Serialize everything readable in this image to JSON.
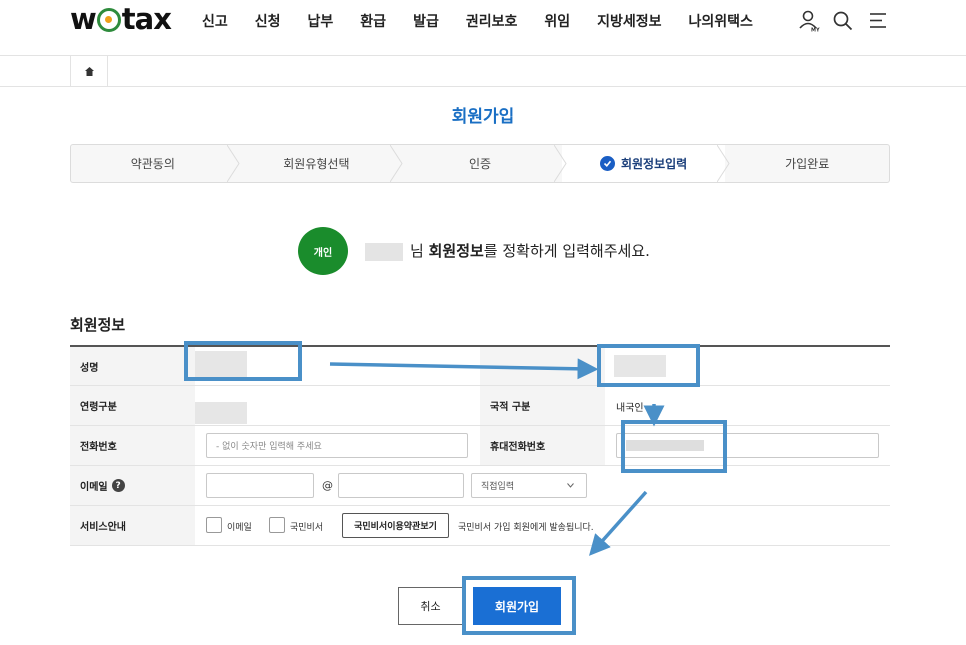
{
  "header": {
    "logo_left": "w",
    "logo_right": "tax",
    "nav": [
      "신고",
      "신청",
      "납부",
      "환급",
      "발급",
      "권리보호",
      "위임",
      "지방세정보",
      "나의위택스"
    ],
    "icons": [
      "user-my-icon",
      "search-icon",
      "menu-icon"
    ],
    "my_label": "MY"
  },
  "breadcrumb": {
    "home_icon": "home-icon"
  },
  "page_title": "회원가입",
  "steps": [
    {
      "label": "약관동의",
      "active": false
    },
    {
      "label": "회원유형선택",
      "active": false
    },
    {
      "label": "인증",
      "active": false
    },
    {
      "label": "회원정보입력",
      "active": true
    },
    {
      "label": "가입완료",
      "active": false
    }
  ],
  "intro": {
    "badge": "개인",
    "suffix": "님",
    "emphasis": "회원정보",
    "rest": "를 정확하게 입력해주세요."
  },
  "section_title": "회원정보",
  "form": {
    "name_label": "성명",
    "age_label": "연령구분",
    "phone_label": "전화번호",
    "phone_placeholder": "- 없이 숫자만 입력해 주세요",
    "email_label": "이메일",
    "email_at": "@",
    "email_domain_select": "직접입력",
    "service_label": "서비스안내",
    "nationality_label": "국적 구분",
    "nationality_value": "내국인",
    "mobile_label": "휴대전화번호",
    "service_option_email": "이메일",
    "service_option_secretary": "국민비서",
    "terms_button": "국민비서이용약관보기",
    "service_note": "국민비서 가입 회원에게 발송됩니다."
  },
  "buttons": {
    "cancel": "취소",
    "join": "회원가입"
  },
  "colors": {
    "primary": "#1a6fd4",
    "title_blue": "#1a6fc4",
    "badge_green": "#1a8c2c",
    "annotation": "#4a90c8"
  }
}
